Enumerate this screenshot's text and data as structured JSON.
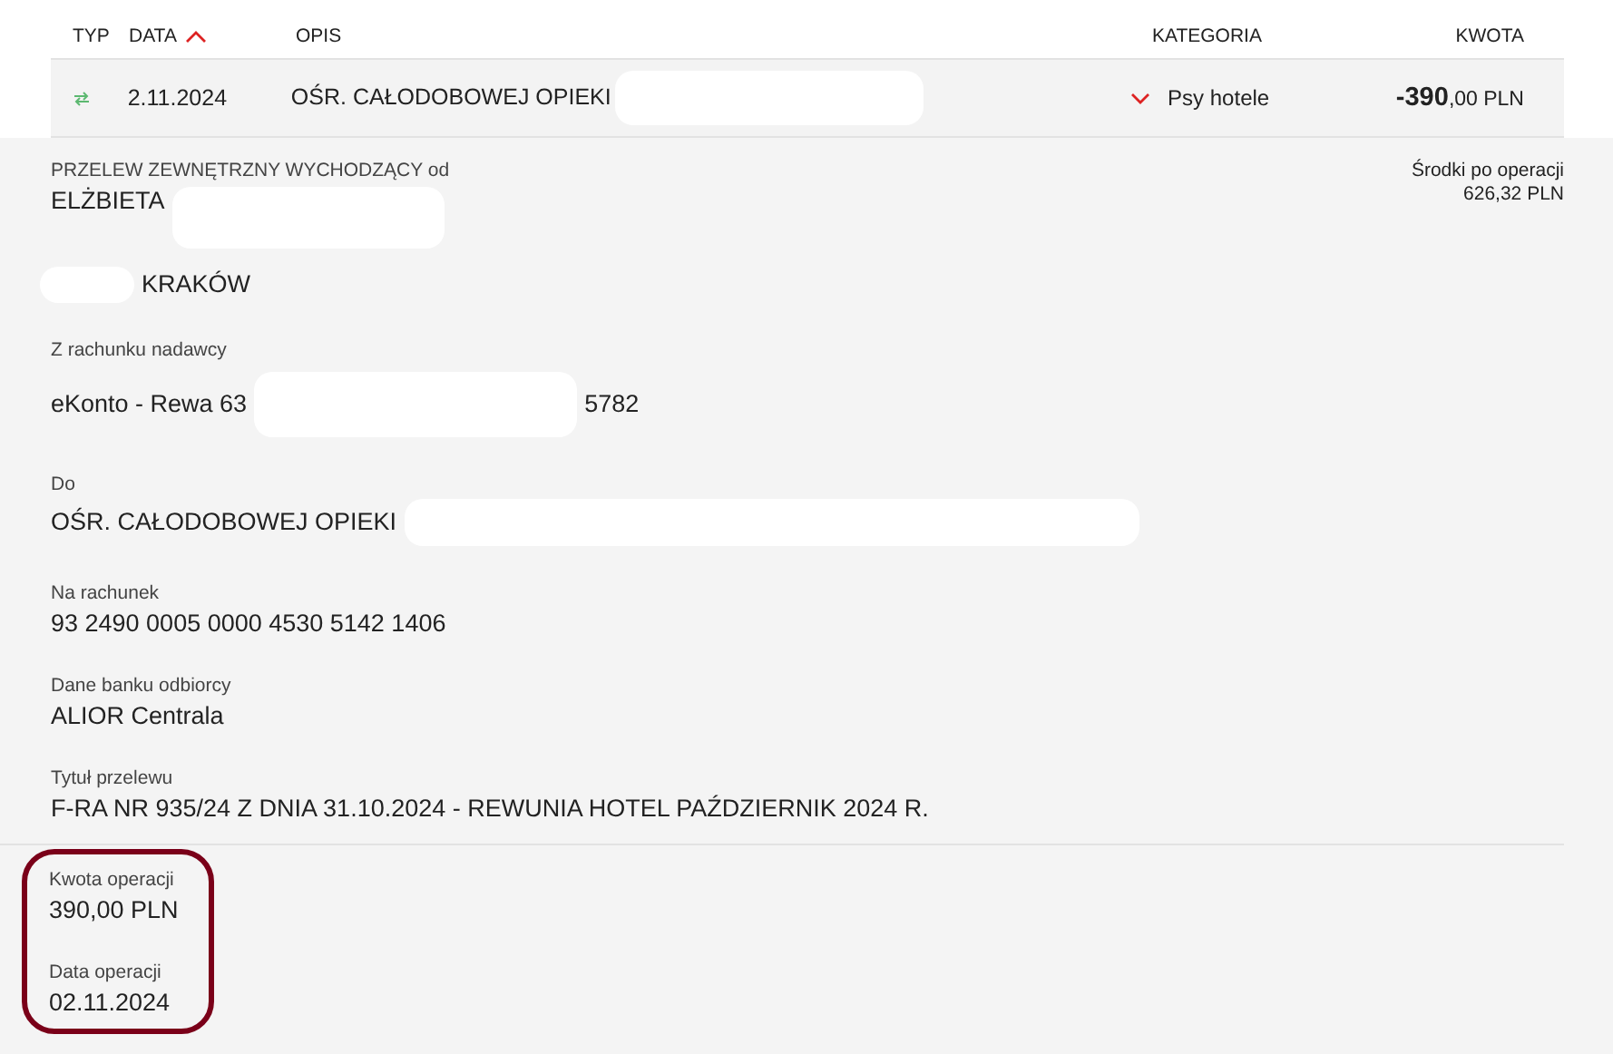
{
  "table": {
    "columns": [
      {
        "label": "TYP",
        "sorted": false
      },
      {
        "label": "DATA",
        "sorted": true
      },
      {
        "label": "OPIS",
        "sorted": false
      },
      {
        "label": "KATEGORIA",
        "sorted": false
      },
      {
        "label": "KWOTA",
        "sorted": false
      }
    ],
    "rows": [
      {
        "kind": "transfer",
        "date": "2.11.2024",
        "description": "OŚR. CAŁODOBOWEJ OPIEKI",
        "category": "Psy hotele",
        "expanded": true,
        "amount_main": "-390",
        "amount_fraction": ",00 PLN"
      }
    ]
  },
  "details": {
    "heading": "PRZELEW ZEWNĘTRZNY WYCHODZĄCY od",
    "sender_name": "ELŻBIETA",
    "sender_city": "KRAKÓW",
    "balance_label": "Środki po operacji",
    "balance": "626,32 PLN",
    "fields": [
      {
        "kind": "account",
        "label": "Z rachunku nadawcy",
        "value": "eKonto - Rewa 63",
        "suffix": "5782"
      },
      {
        "kind": "recipient",
        "label": "Do",
        "value": "OŚR. CAŁODOBOWEJ OPIEKI"
      },
      {
        "kind": "plain",
        "label": "Na rachunek",
        "value": "93 2490 0005 0000 4530 5142 1406"
      },
      {
        "kind": "plain",
        "label": "Dane banku odbiorcy",
        "value": "ALIOR Centrala"
      },
      {
        "kind": "plain",
        "label": "Tytuł przelewu",
        "value": "F-RA NR 935/24 Z DNIA 31.10.2024 - REWUNIA HOTEL PAŹDZIERNIK 2024 R."
      }
    ],
    "summary": {
      "highlighted": true,
      "fields": [
        {
          "label": "Kwota operacji",
          "value": "390,00 PLN"
        },
        {
          "label": "Data operacji",
          "value": "02.11.2024"
        }
      ]
    }
  }
}
